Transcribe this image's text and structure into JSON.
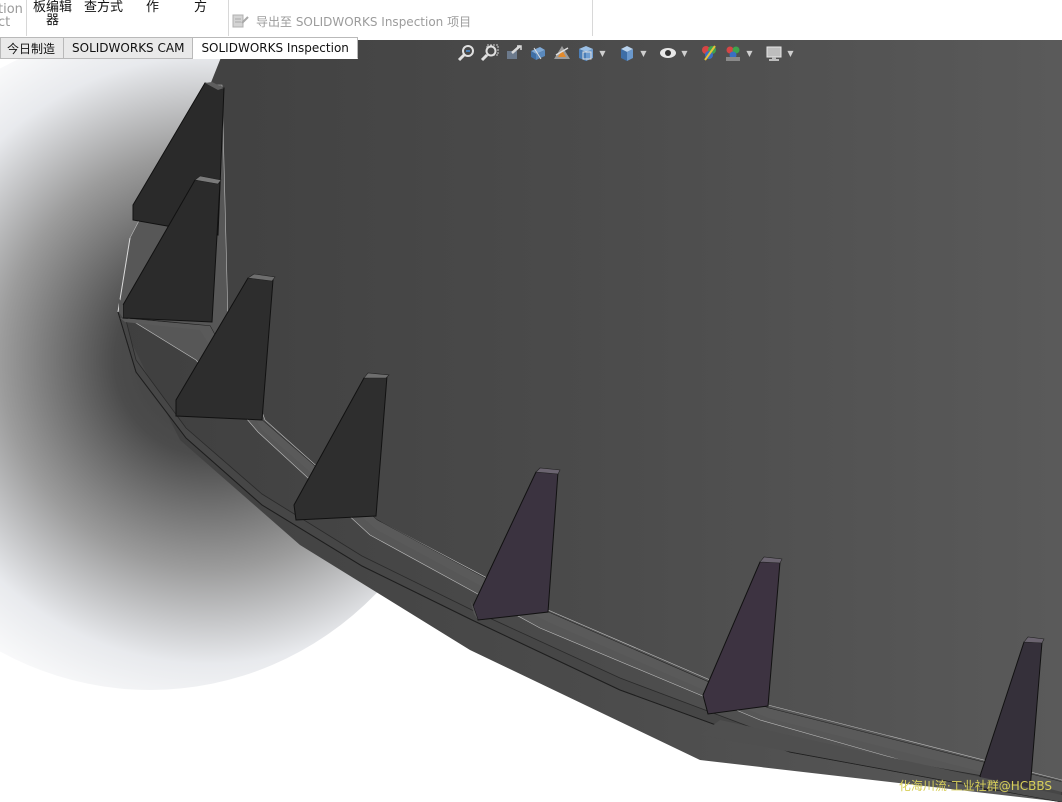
{
  "ribbon": {
    "left_partial_1": "tion",
    "left_partial_2": "ct",
    "btn1_line1": "板编辑",
    "btn1_line2": "器",
    "btn2_line": "查方式",
    "btn3_line": "作",
    "btn4_line": "方",
    "export_label": "导出至 SOLIDWORKS Inspection 项目"
  },
  "tabs": [
    {
      "label": "今日制造",
      "active": false
    },
    {
      "label": "SOLIDWORKS CAM",
      "active": false
    },
    {
      "label": "SOLIDWORKS Inspection",
      "active": true
    }
  ],
  "hud_icons": [
    "zoom-to-fit-icon",
    "zoom-to-area-icon",
    "previous-view-icon",
    "section-view-icon",
    "dynamic-annotation-views-icon",
    "view-orientation-icon",
    "display-style-icon",
    "hide-show-items-icon",
    "edit-appearance-icon",
    "apply-scene-icon",
    "view-settings-icon"
  ],
  "watermark": "化海川流·工业社群@HCBBS",
  "colors": {
    "viewport_dark": "#4a4a4a",
    "ring_face": "#585858",
    "gusset_face": "#2b2b2b",
    "gusset_purple": "#3e3440",
    "watermark": "#d8cf5a"
  }
}
